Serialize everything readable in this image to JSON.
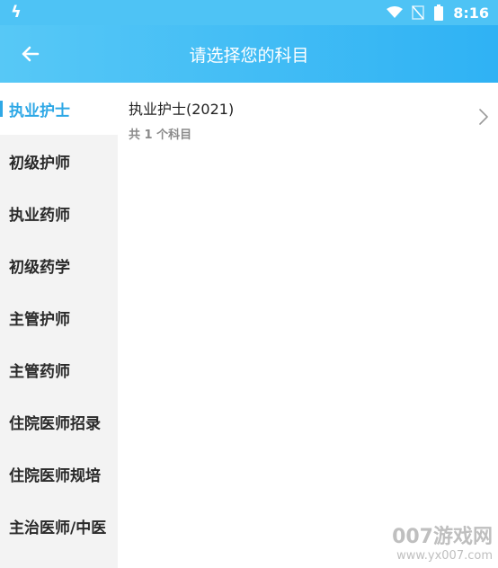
{
  "status_bar": {
    "time": "8:16",
    "icons": [
      "app-notification-icon",
      "wifi-icon",
      "no-signal-icon",
      "battery-icon"
    ]
  },
  "app_bar": {
    "title": "请选择您的科目",
    "back_icon": "arrow-left-icon"
  },
  "sidebar": {
    "active_index": 0,
    "items": [
      {
        "label": "执业护士"
      },
      {
        "label": "初级护师"
      },
      {
        "label": "执业药师"
      },
      {
        "label": "初级药学"
      },
      {
        "label": "主管护师"
      },
      {
        "label": "主管药师"
      },
      {
        "label": "住院医师招录"
      },
      {
        "label": "住院医师规培"
      },
      {
        "label": "主治医师/中医"
      }
    ]
  },
  "subjects": [
    {
      "name": "执业护士(2021)",
      "count_text": "共 1 个科目"
    }
  ],
  "watermark": {
    "brand": "007游戏网",
    "url": "www.yx007.com"
  },
  "colors": {
    "accent": "#2ea8e6",
    "app_bar_start": "#57c8f6",
    "app_bar_end": "#2fb2f4",
    "sidebar_bg": "#f3f3f3"
  }
}
